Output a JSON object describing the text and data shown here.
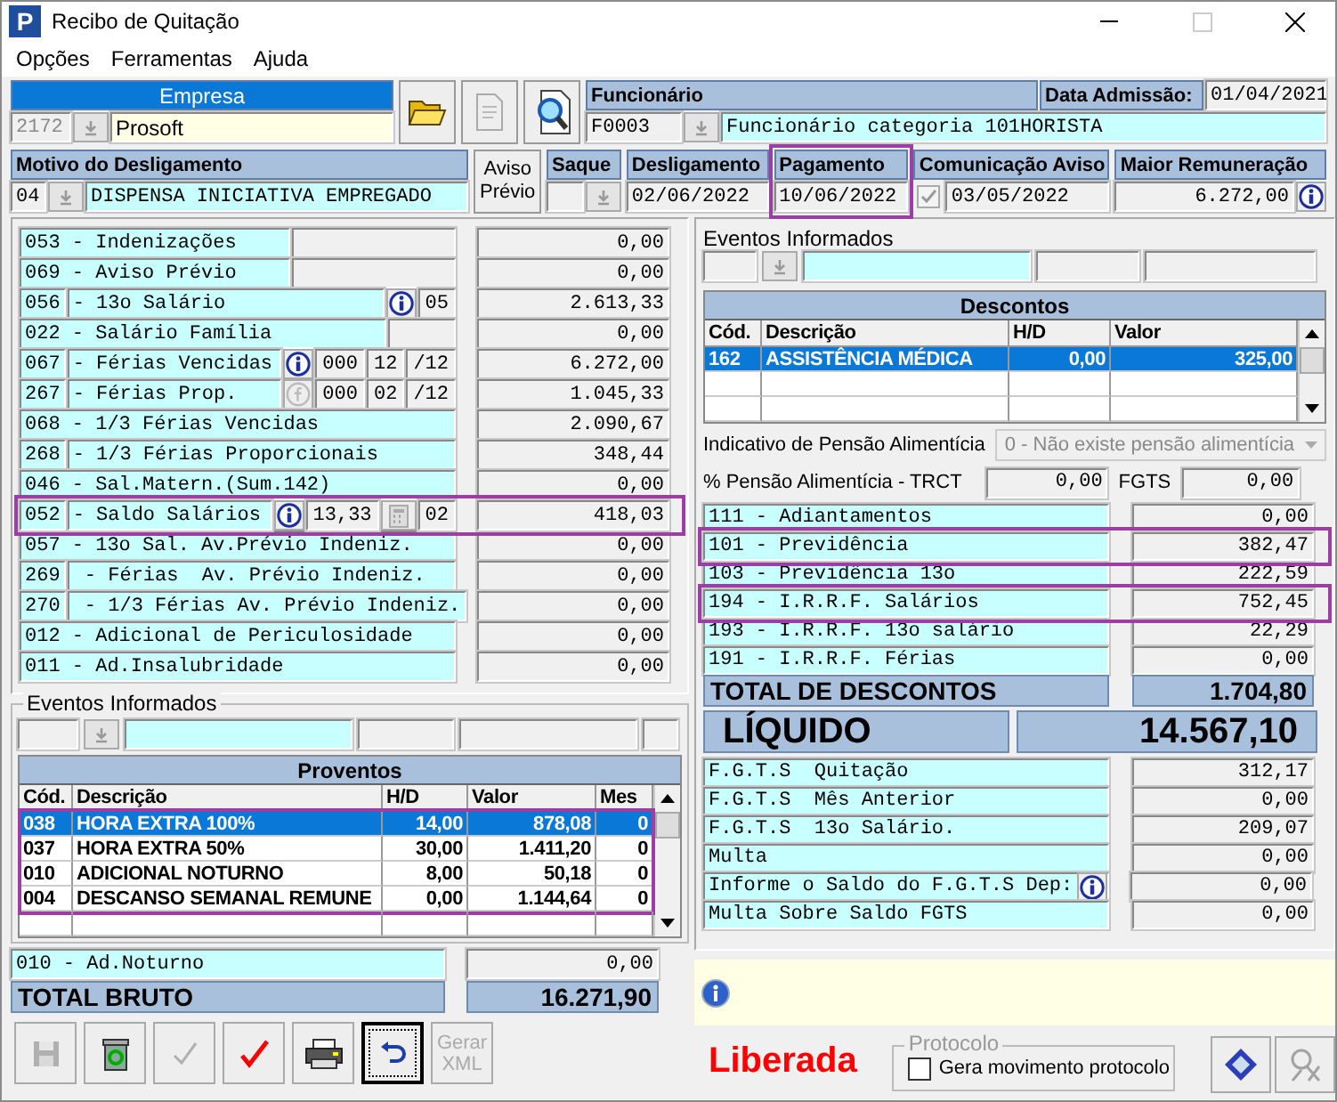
{
  "window": {
    "icon_text": "P",
    "title": "Recibo de Quitação"
  },
  "menu": [
    "Opções",
    "Ferramentas",
    "Ajuda"
  ],
  "empresa": {
    "label": "Empresa",
    "focused": true,
    "code": "2172",
    "name": "Prosoft"
  },
  "funcionario": {
    "label": "Funcionário",
    "code": "F0003",
    "name": "Funcionário categoria 101HORISTA"
  },
  "admissao": {
    "label": "Data Admissão:",
    "value": "01/04/2021"
  },
  "motivo": {
    "label": "Motivo do Desligamento",
    "code": "04",
    "value": "DISPENSA INICIATIVA EMPREGADO"
  },
  "aviso_button": "Aviso Prévio",
  "saque": {
    "label": "Saque"
  },
  "desligamento": {
    "label": "Desligamento",
    "value": "02/06/2022"
  },
  "pagamento": {
    "label": "Pagamento",
    "value": "10/06/2022",
    "highlighted": true
  },
  "comunicacao": {
    "label": "Comunicação Aviso",
    "checked": true,
    "value": "03/05/2022"
  },
  "maior": {
    "label": "Maior Remuneração",
    "value": "6.272,00"
  },
  "earnings": [
    {
      "label": "053 - Indenizações",
      "value": "0,00",
      "extras": [
        {
          "kind": "blank-wide"
        }
      ],
      "highlighted": false
    },
    {
      "label": "069 - Aviso Prévio",
      "value": "0,00",
      "extras": [
        {
          "kind": "blank-wide"
        }
      ],
      "highlighted": false
    },
    {
      "code": "056",
      "label": "- 13o Salário",
      "value": "2.613,33",
      "extras": [
        {
          "kind": "info"
        },
        {
          "kind": "field",
          "text": "05"
        }
      ],
      "highlighted": false
    },
    {
      "label": "022 - Salário Família",
      "value": "0,00",
      "extras": [
        {
          "kind": "blank"
        }
      ],
      "highlighted": false
    },
    {
      "code": "067",
      "label": "- Férias Vencidas",
      "value": "6.272,00",
      "extras": [
        {
          "kind": "info"
        },
        {
          "kind": "field",
          "text": "000"
        },
        {
          "kind": "field",
          "text": "12"
        },
        {
          "kind": "field",
          "text": "/12"
        }
      ],
      "highlighted": false
    },
    {
      "code": "267",
      "label": "- Férias Prop.",
      "value": "1.045,33",
      "extras": [
        {
          "kind": "formula"
        },
        {
          "kind": "field",
          "text": "000"
        },
        {
          "kind": "field",
          "text": "02"
        },
        {
          "kind": "field",
          "text": "/12"
        }
      ],
      "highlighted": false
    },
    {
      "label": "068 - 1/3 Férias Vencidas",
      "value": "2.090,67",
      "highlighted": false
    },
    {
      "code": "268",
      "label": "- 1/3 Férias Proporcionais",
      "value": "348,44",
      "highlighted": false
    },
    {
      "label": "046 - Sal.Matern.(Sum.142)",
      "value": "0,00",
      "highlighted": false
    },
    {
      "code": "052",
      "label": "- Saldo Salários",
      "value": "418,03",
      "extras": [
        {
          "kind": "info"
        },
        {
          "kind": "field",
          "text": "13,33"
        },
        {
          "kind": "calc"
        },
        {
          "kind": "field",
          "text": "02"
        }
      ],
      "highlighted": true
    },
    {
      "label": "057 - 13o Sal. Av.Prévio Indeniz.",
      "value": "0,00",
      "highlighted": false
    },
    {
      "code": "269",
      "label": " - Férias  Av. Prévio Indeniz.",
      "value": "0,00",
      "highlighted": false
    },
    {
      "code": "270",
      "label": " - 1/3 Férias Av. Prévio Indeniz.",
      "value": "0,00",
      "highlighted": false
    },
    {
      "label": "012 - Adicional de Periculosidade",
      "value": "0,00",
      "highlighted": false
    },
    {
      "label": "011 - Ad.Insalubridade",
      "value": "0,00",
      "highlighted": false
    }
  ],
  "left_events": {
    "label": "Eventos Informados"
  },
  "proventos": {
    "title": "Proventos",
    "columns": [
      "Cód.",
      "Descrição",
      "H/D",
      "Valor",
      "Mes"
    ],
    "rows": [
      {
        "cells": [
          "038",
          "HORA EXTRA 100%",
          "14,00",
          "878,08",
          "0"
        ],
        "selected": true,
        "highlighted": true
      },
      {
        "cells": [
          "037",
          "HORA EXTRA 50%",
          "30,00",
          "1.411,20",
          "0"
        ],
        "selected": false,
        "highlighted": true
      },
      {
        "cells": [
          "010",
          "ADICIONAL NOTURNO",
          "8,00",
          "50,18",
          "0"
        ],
        "selected": false,
        "highlighted": true
      },
      {
        "cells": [
          "004",
          "DESCANSO SEMANAL REMUNE",
          "0,00",
          "1.144,64",
          "0"
        ],
        "selected": false,
        "highlighted": true
      }
    ]
  },
  "ad_noturno": {
    "label": "010 - Ad.Noturno",
    "value": "0,00"
  },
  "total_bruto": {
    "label": "TOTAL BRUTO",
    "value": "16.271,90"
  },
  "toolbar": [
    {
      "kind": "save",
      "disabled": true,
      "focused": false
    },
    {
      "kind": "recycle",
      "disabled": false,
      "focused": false
    },
    {
      "kind": "check",
      "disabled": true,
      "focused": false
    },
    {
      "kind": "confirm",
      "disabled": false,
      "focused": false
    },
    {
      "kind": "print",
      "disabled": false,
      "focused": false
    },
    {
      "kind": "undo",
      "disabled": false,
      "focused": true
    },
    {
      "kind": "text",
      "label": "Gerar XML",
      "disabled": true,
      "focused": false
    }
  ],
  "right_events": {
    "label": "Eventos Informados"
  },
  "descontos": {
    "title": "Descontos",
    "columns": [
      "Cód.",
      "Descrição",
      "H/D",
      "Valor"
    ],
    "rows": [
      {
        "cells": [
          "162",
          "ASSISTÊNCIA MÉDICA",
          "0,00",
          "325,00"
        ],
        "selected": true,
        "highlighted": false
      }
    ]
  },
  "pensao": {
    "label": "Indicativo de Pensão Alimentícia",
    "value": "0 - Não existe pensão alimentícia",
    "disabled": true
  },
  "trct": {
    "label": "% Pensão Alimentícia - TRCT",
    "value": "0,00"
  },
  "fgts": {
    "label": "FGTS",
    "value": "0,00"
  },
  "deductions": [
    {
      "label": "111 - Adiantamentos",
      "value": "0,00",
      "highlighted": false
    },
    {
      "label": "101 - Previdência",
      "value": "382,47",
      "highlighted": true
    },
    {
      "label": "103 - Previdência 13o",
      "value": "222,59",
      "highlighted": false
    },
    {
      "label": "194 - I.R.R.F. Salários",
      "value": "752,45",
      "highlighted": true
    },
    {
      "label": "193 - I.R.R.F. 13o salário",
      "value": "22,29",
      "highlighted": false
    },
    {
      "label": "191 - I.R.R.F. Férias",
      "value": "0,00",
      "highlighted": false
    }
  ],
  "total_descontos": {
    "label": "TOTAL DE DESCONTOS",
    "value": "1.704,80"
  },
  "liquido": {
    "label": "LÍQUIDO",
    "value": "14.567,10"
  },
  "fgts_rows": [
    {
      "label": "F.G.T.S  Quitação",
      "value": "312,17"
    },
    {
      "label": "F.G.T.S  Mês Anterior",
      "value": "0,00"
    },
    {
      "label": "F.G.T.S  13o Salário.",
      "value": "209,07"
    },
    {
      "label": "Multa",
      "value": "0,00"
    },
    {
      "label": "Informe o Saldo do F.G.T.S Dep:",
      "value": "0,00",
      "kind": "info"
    },
    {
      "label": "Multa Sobre Saldo FGTS",
      "value": "0,00"
    }
  ],
  "status": {
    "text": "Liberada"
  },
  "protocolo": {
    "label": "Protocolo",
    "checkbox": "Gera movimento protocolo",
    "checked": false
  },
  "bottom_buttons": [
    {
      "kind": "target",
      "disabled": false
    },
    {
      "kind": "tools",
      "disabled": true
    }
  ]
}
